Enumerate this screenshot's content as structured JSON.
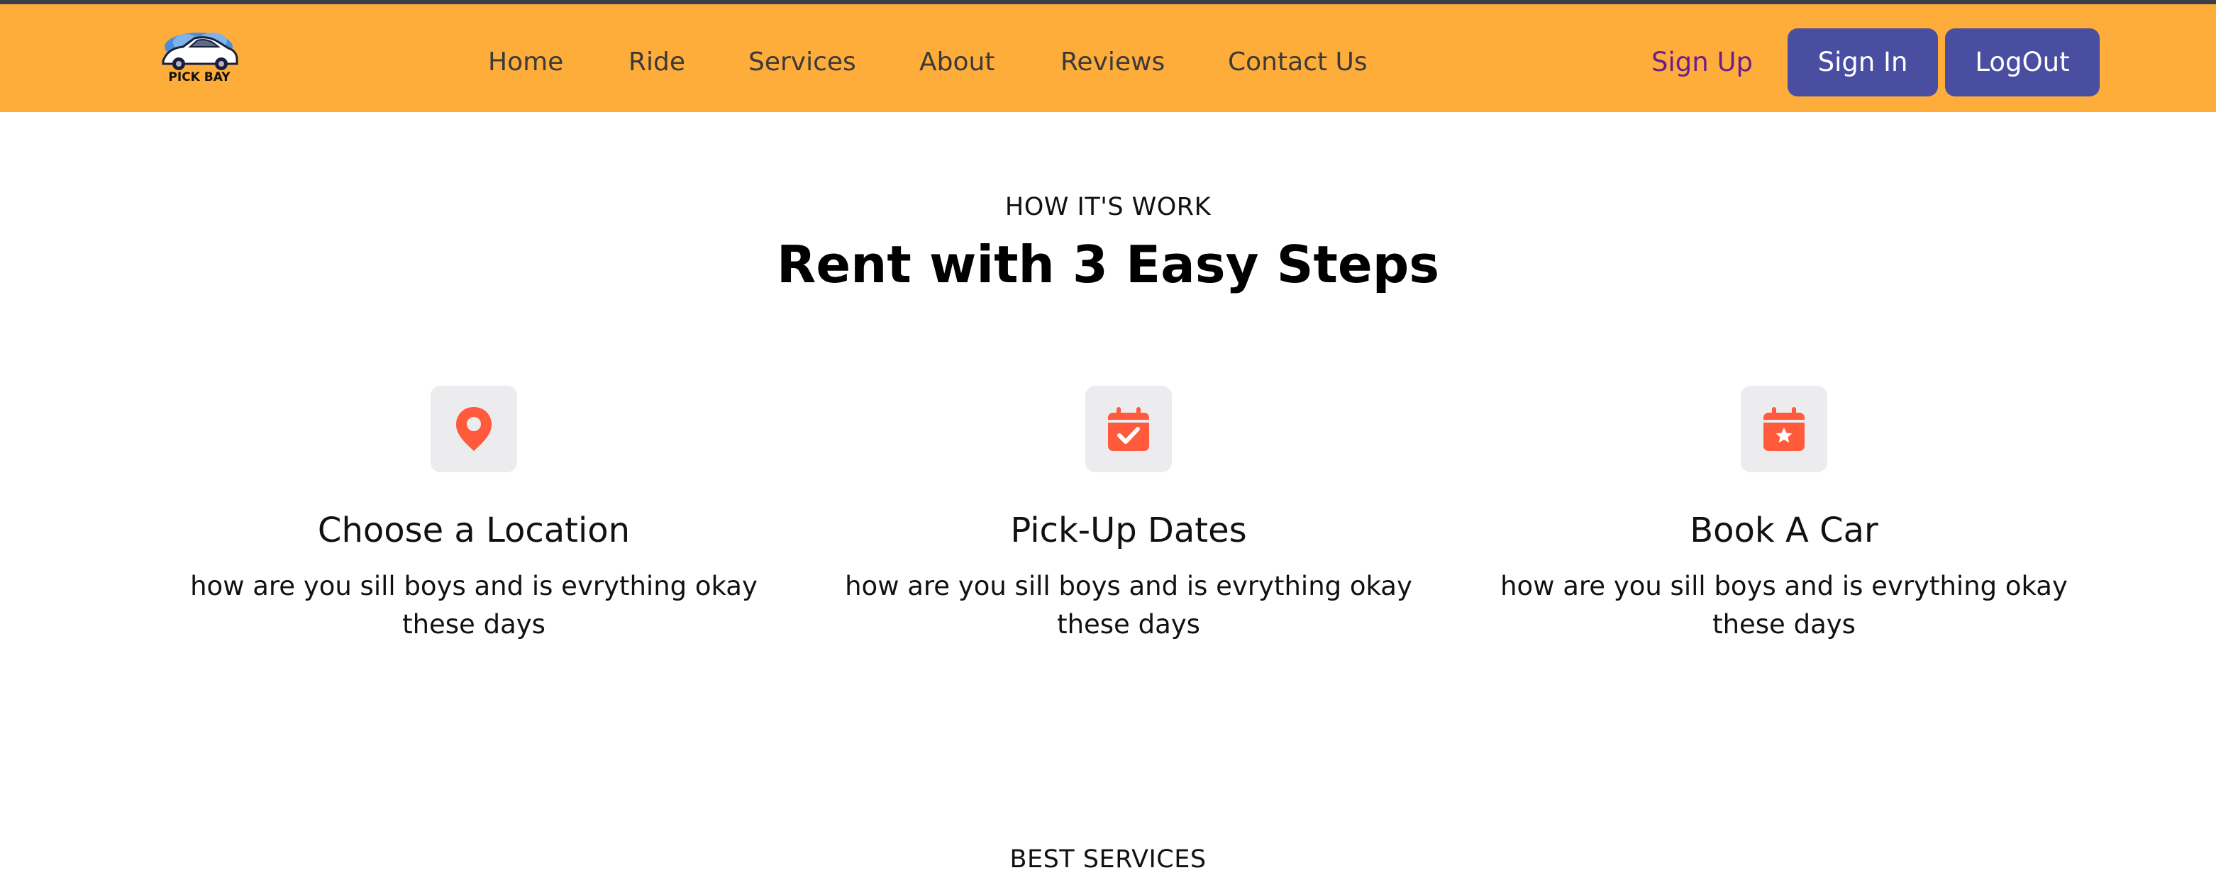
{
  "brand": {
    "logo_text": "PICK BAY",
    "accent_color": "#ffad3a",
    "button_color": "#4a4ea1",
    "icon_color": "#ff5a3c"
  },
  "nav": {
    "links": [
      "Home",
      "Ride",
      "Services",
      "About",
      "Reviews",
      "Contact Us"
    ],
    "signup_label": "Sign Up",
    "signin_label": "Sign In",
    "logout_label": "LogOut"
  },
  "how_it_works": {
    "eyebrow": "HOW IT'S WORK",
    "heading": "Rent with 3 Easy Steps",
    "steps": [
      {
        "icon": "location-pin-icon",
        "title": "Choose a Location",
        "description": "how are you sill boys and is evrything okay these days"
      },
      {
        "icon": "calendar-check-icon",
        "title": "Pick-Up Dates",
        "description": "how are you sill boys and is evrything okay these days"
      },
      {
        "icon": "calendar-star-icon",
        "title": "Book A Car",
        "description": "how are you sill boys and is evrything okay these days"
      }
    ]
  },
  "best_services": {
    "eyebrow": "BEST SERVICES"
  }
}
